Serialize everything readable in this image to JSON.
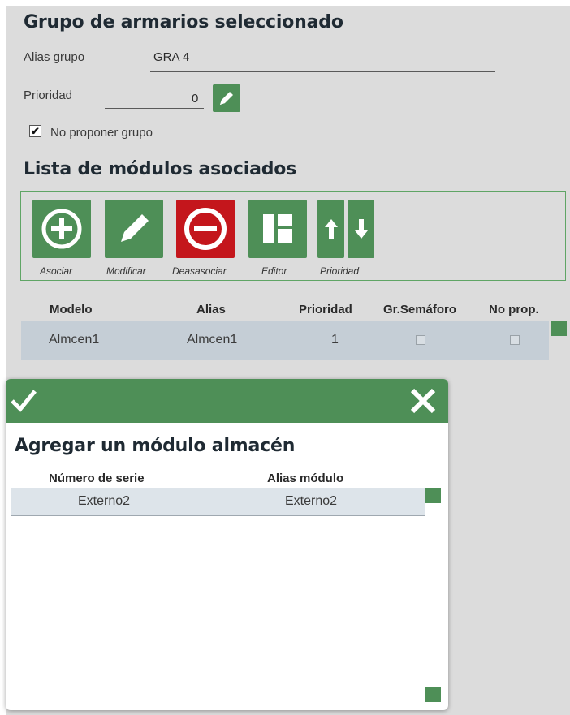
{
  "group": {
    "title": "Grupo de armarios seleccionado",
    "alias_label": "Alias grupo",
    "alias_value": "GRA 4",
    "priority_label": "Prioridad",
    "priority_value": "0",
    "no_propose_label": "No proponer grupo",
    "no_propose_checked": true
  },
  "modules": {
    "title": "Lista de módulos asociados",
    "toolbar": [
      {
        "label": "Asociar",
        "icon": "plus-circle-icon"
      },
      {
        "label": "Modificar",
        "icon": "pencil-icon"
      },
      {
        "label": "Deasasociar",
        "icon": "minus-circle-icon"
      },
      {
        "label": "Editor",
        "icon": "layout-editor-icon"
      },
      {
        "label": "Prioridad",
        "icon": "priority-arrows-icon"
      }
    ],
    "columns": [
      "Modelo",
      "Alias",
      "Prioridad",
      "Gr.Semáforo",
      "No prop."
    ],
    "rows": [
      {
        "modelo": "Almcen1",
        "alias": "Almcen1",
        "prioridad": "1",
        "semaforo": false,
        "no_prop": false
      }
    ]
  },
  "dialog": {
    "title": "Agregar un módulo almacén",
    "columns": [
      "Número de serie",
      "Alias módulo"
    ],
    "rows": [
      {
        "serie": "Externo2",
        "alias": "Externo2"
      }
    ]
  },
  "colors": {
    "accent": "#4e8f57",
    "danger": "#c4161c",
    "panel": "#dcdcdc",
    "selected_row": "#c5ced6"
  }
}
